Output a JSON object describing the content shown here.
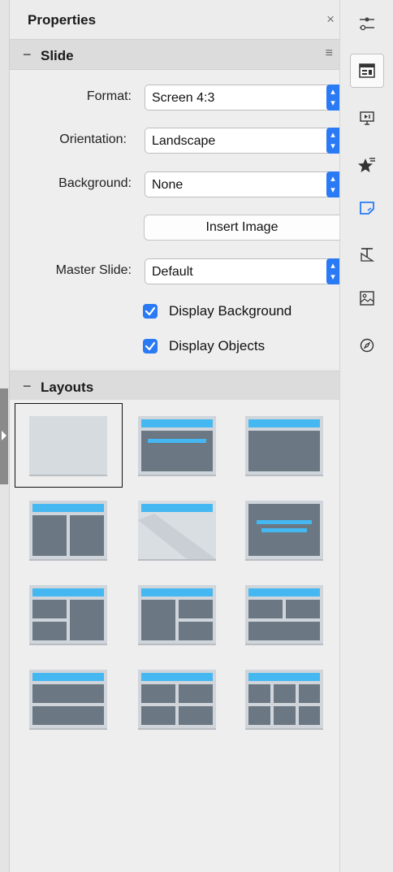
{
  "panel": {
    "title": "Properties",
    "close_glyph": "×"
  },
  "slide_section": {
    "toggle_glyph": "−",
    "label": "Slide",
    "menu_glyph": "≡",
    "format": {
      "label": "Format:",
      "value": "Screen 4:3"
    },
    "orientation": {
      "label": "Orientation:",
      "value": "Landscape"
    },
    "background": {
      "label": "Background:",
      "value": "None"
    },
    "insert_image_label": "Insert Image",
    "master_slide": {
      "label": "Master Slide:",
      "value": "Default"
    },
    "display_background": {
      "label": "Display Background",
      "checked": true
    },
    "display_objects": {
      "label": "Display Objects",
      "checked": true
    },
    "stepper_glyph": "⌃⌄"
  },
  "layouts_section": {
    "toggle_glyph": "−",
    "label": "Layouts",
    "items": [
      "blank-slide",
      "title-content",
      "title-content-box",
      "title-two-columns",
      "title-only",
      "centered-text",
      "title-content-two-left",
      "title-two-content-right",
      "title-two-content-over",
      "title-two-rows",
      "title-four-content",
      "title-six-content"
    ],
    "selected_index": 0
  },
  "sidebar_rail": {
    "buttons": [
      "properties-icon",
      "slide-layout-icon",
      "slide-transition-icon",
      "animation-icon",
      "master-slides-icon",
      "styles-icon",
      "gallery-icon",
      "navigator-icon"
    ],
    "active": "slide-layout-icon"
  },
  "colors": {
    "accent": "#2a7af5",
    "layout_title_bar": "#45b8f2",
    "layout_dark": "#6b7782"
  }
}
